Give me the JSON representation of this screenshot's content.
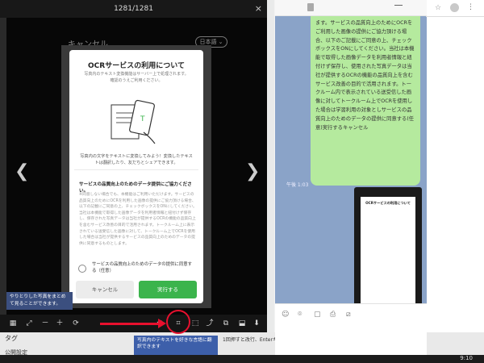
{
  "viewer": {
    "title": "1281/1281",
    "close_label": "×",
    "behind_cancel": "キャンセル",
    "behind_lang": "日本語 ⌄",
    "prev_arrow": "❮",
    "next_arrow": "❯"
  },
  "dialog": {
    "title": "OCRサービスの利用について",
    "subtitle": "写真内のテキスト変換機能はサーバー上で処理されます。確認のうえご利用ください。",
    "caption": "写真内の文字をテキストに変換してみよう！変換したテキストは翻訳したり、友だちとシェアできます。",
    "heading": "サービスの品質向上のためのデータ提供にご協力ください。",
    "body": "※同意しない場合でも、本機能はご利用いただけます。サービスの品質向上のためにOCRを利用した画像の提供にご協力頂ける場合、以下の記載にご同意の上、チェックボックスをONにしてください。当社は本機能で取得した画像データを利用者情報と紐付けず保存し、保存された写真データは当社が提供するOCRの機能の品質向上を含むサービス改善の目的で活用されます。トークルーム上に表示されている送受信した画像に対して、トークルーム上でOCRを使用した場合は当社が提供するサービスの品質向上のためのデータの提供に同意するものとします。",
    "check_label": "サービスの品質向上のためのデータの提供に同意する（任意）",
    "cancel_label": "キャンセル",
    "run_label": "実行する"
  },
  "tooltips": {
    "left": "やりとりした写真をまとめて見ることができます。",
    "bottom": "写真内のテキストを好きな言語に翻訳できます"
  },
  "toolbar": {
    "items": [
      "▦",
      "⤢",
      "－",
      "＋",
      "⟳",
      "⟲",
      "⌗",
      "⬚",
      "⤴",
      "⧉",
      "⬓",
      "⬇"
    ]
  },
  "chat": {
    "bubble_text": "ます。サービスの品質向上のためにOCRをご利用した画像の提供にご協力頂ける場合、以下のご記載にご同意の上、チェックボックスをONにしてください。当社は本機能で取得した画像データを利用者情報と紐付けず保存し、使用された写真データは当社が提供するOCRの機能の品質向上を含むサービス改善の目的で活用されます。トークルーム内で表示されている送受信した画像に対してトークルーム上でOCRを使用した場合は学習利用の対象としサービスの品質向上のためのデータの提供に同意する(任意)実行するキャンセル",
    "time": "午後 1:03",
    "image_title": "OCRサービスの利用について",
    "input_icons": [
      "☺",
      "⌾",
      "▢",
      "⎙",
      "⧄"
    ]
  },
  "desktop": {
    "left_text_1": "タグ",
    "left_text_2": "公開設定",
    "bottom_right_text": "1回押すと改行、Enterキー",
    "clock": "9:10"
  },
  "browser": {
    "star": "☆",
    "menu": "⋮"
  },
  "colors": {
    "green_button": "#3bb44c",
    "chat_bg": "#8aa3c8",
    "bubble": "#b5ea9e",
    "annotation_red": "#e8102e",
    "tooltip_blue": "#3d5faa"
  }
}
